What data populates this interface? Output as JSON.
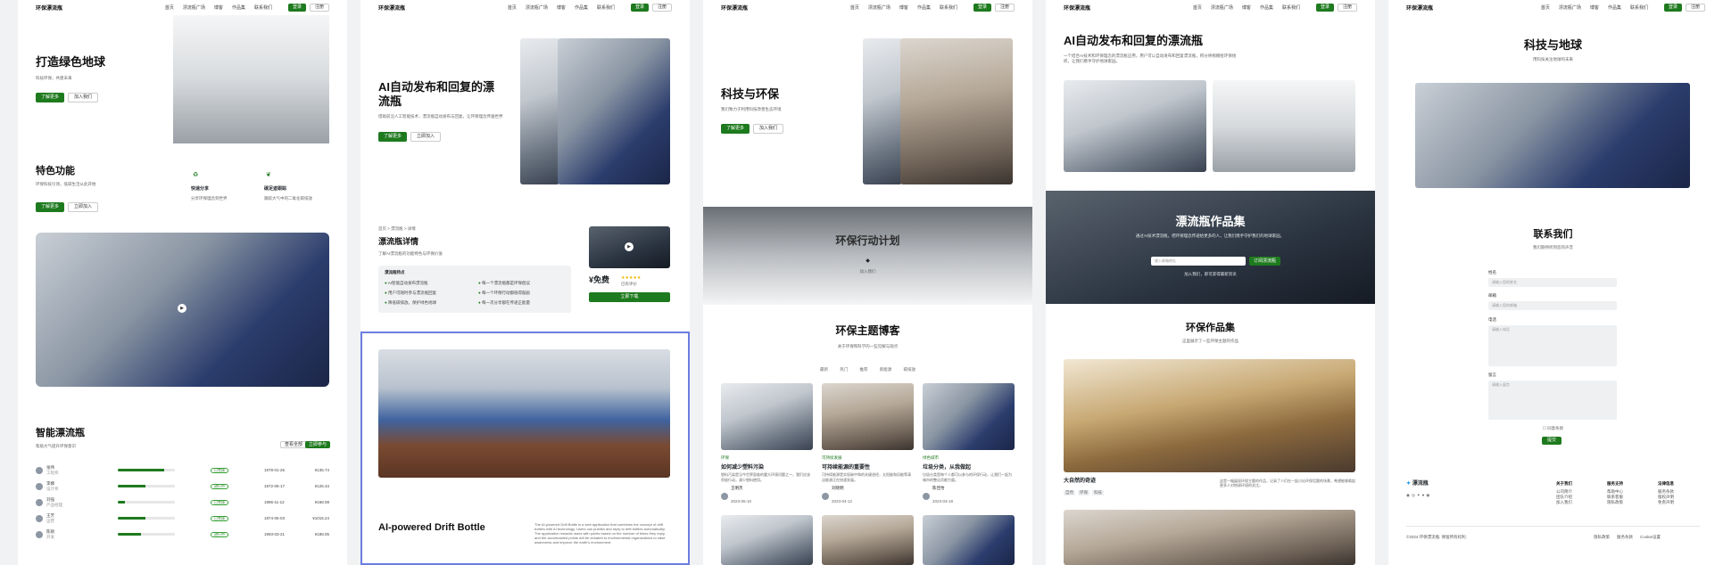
{
  "brand": "环保漂流瓶",
  "nav_links": [
    "首页",
    "漂流瓶广场",
    "博客",
    "作品集",
    "联系我们"
  ],
  "nav_btn_primary": "登录",
  "nav_btn_secondary": "注册",
  "p1": {
    "hero_title": "打造绿色地球",
    "hero_sub": "科技环保，共建未来",
    "btn_primary": "了解更多",
    "btn_secondary": "加入我们",
    "features_title": "特色功能",
    "features_sub": "环保科技引领，低碳生活从此开始",
    "features_btn_primary": "了解更多",
    "features_btn_secondary": "立即加入",
    "feature1_title": "快速分享",
    "feature1_desc": "分享环保理念到世界",
    "feature2_title": "碳足迹跟踪",
    "feature2_desc": "跟踪大气中的二氧化碳排放",
    "table_title": "智能漂流瓶",
    "table_sub": "帮助大气提升环保意识",
    "table_btn_secondary": "查看全部",
    "table_btn_primary": "立即参与",
    "rows": [
      {
        "name": "张伟",
        "role": "工程师",
        "progress": 0.82,
        "status": "已完成",
        "date": "1978-01-26",
        "value": "¥135.74"
      },
      {
        "name": "李娜",
        "role": "设计师",
        "progress": 0.48,
        "status": "进行中",
        "date": "1972-05-17",
        "value": "¥126.34"
      },
      {
        "name": "刘强",
        "role": "产品经理",
        "progress": 0.12,
        "status": "已完成",
        "date": "1996-11-12",
        "value": "¥168.08"
      },
      {
        "name": "王芳",
        "role": "运营",
        "progress": 0.48,
        "status": "已完成",
        "date": "1974-05-03",
        "value": "¥1015.24"
      },
      {
        "name": "陈刚",
        "role": "开发",
        "progress": 0.4,
        "status": "进行中",
        "date": "1993-03-21",
        "value": "¥188.05"
      }
    ]
  },
  "p2": {
    "hero_title": "AI自动发布和回复的漂流瓶",
    "hero_sub": "借助前沿人工智能技术，漂流瓶自动发布与回复，让环保理念传遍世界",
    "btn_primary": "了解更多",
    "btn_secondary": "立即加入",
    "breadcrumb": [
      "首页",
      "漂流瓶",
      "详情"
    ],
    "detail_title": "漂流瓶详情",
    "detail_sub": "了解AI漂流瓶的功能特色与环保价值",
    "features_box_title": "漂流瓶特点",
    "features": [
      "AI智能自动发布漂流瓶",
      "每一个漂流瓶都是环保倡议",
      "用户可随时参与漂流瓶回复",
      "每一个环保行动都值得鼓励",
      "降低碳排放，保护绿色地球",
      "每一次分享都在传递正能量"
    ],
    "price": "¥免费",
    "rating_label": "已有评价",
    "buy_btn": "立即下载",
    "product_title": "AI-powered Drift Bottle",
    "product_desc": "The AI-powered Drift Bottle is a web application that combines the concept of drift bottles with AI technology. Users can publish and reply to drift bottles automatically. The application rewards users with points based on the number of times they reply, and the accumulated points will be donated to environmental organizations to raise awareness and improve the earth's environment."
  },
  "p3": {
    "hero_title": "科技与环保",
    "hero_sub": "我们致力于利用科技改善生态环境",
    "btn_primary": "了解更多",
    "btn_secondary": "加入我们",
    "banner_title": "环保行动计划",
    "banner_sub": "加入我们",
    "blog_title": "环保主题博客",
    "blog_sub": "关于环保和科学的一些见解与观点",
    "tabs": [
      "最新",
      "热门",
      "推荐",
      "新能源",
      "碳排放"
    ],
    "posts": [
      {
        "tag": "环保",
        "title": "如何减少塑料污染",
        "excerpt": "塑料污染是当今世界面临的重大环境问题之一，我们应该积极行动，减少塑料使用。",
        "author": "王明杰",
        "date": "2023-05-10"
      },
      {
        "tag": "可持续发展",
        "title": "可持续能源的重要性",
        "excerpt": "可持续能源是实现碳中和的关键途径，太阳能和风能等清洁能源正在快速发展。",
        "author": "刘晓明",
        "date": "2023-04-12"
      },
      {
        "tag": "绿色城市",
        "title": "垃圾分类，从我做起",
        "excerpt": "垃圾分类是每个人都可以参与的环保行动，让我们一起为城市的整洁贡献力量。",
        "author": "陈佳怡",
        "date": "2023-03-18"
      }
    ]
  },
  "p4": {
    "hero_title": "AI自动发布和回复的漂流瓶",
    "hero_sub": "一个结合AI技术和环保理念的漂流瓶应用，用户可以自动发布和回复漂流瓶，积分将捐赠给环保组织，让我们携手守护地球家园。",
    "gallery_banner_title": "漂流瓶作品集",
    "gallery_banner_sub": "通过AI技术漂流瓶，把环保理念传递给更多的人，让我们携手守护我们的地球家园。",
    "email_placeholder": "输入邮箱地址",
    "subscribe_btn": "订阅漂流瓶",
    "banner_note": "加入我们，即可获得最新资讯",
    "gallery_title": "环保作品集",
    "gallery_sub": "这里展示了一些环保主题的作品",
    "work_title": "大自然的奇迹",
    "work_desc": "这是一幅展现环保主题的作品，记录了人们在一起讨论环保话题的场景，希望能够唤起更多人对地球环境的关注。",
    "work_tags": [
      "自然",
      "环保",
      "科技"
    ]
  },
  "p5": {
    "hero_title": "科技与地球",
    "hero_sub": "用科技关注地球的未来",
    "contact_title": "联系我们",
    "contact_sub": "我们期待听到您的声音",
    "fields": [
      {
        "label": "姓名",
        "placeholder": "请输入您的姓名"
      },
      {
        "label": "邮箱",
        "placeholder": "请输入您的邮箱"
      },
      {
        "label": "电话",
        "placeholder": "请输入电话"
      },
      {
        "label": "留言",
        "placeholder": "请输入留言"
      }
    ],
    "agree_label": "同意条款",
    "submit_btn": "提交",
    "footer_brand": "漂流瓶",
    "footer_cols": [
      {
        "title": "关于我们",
        "items": [
          "公司简介",
          "团队介绍",
          "加入我们"
        ]
      },
      {
        "title": "服务支持",
        "items": [
          "帮助中心",
          "联系客服",
          "隐私政策"
        ]
      },
      {
        "title": "法律信息",
        "items": [
          "服务条款",
          "版权声明",
          "免责声明"
        ]
      }
    ],
    "copyright": "©2024 环保漂流瓶. 保留所有权利.",
    "footer_links": [
      "隐私政策",
      "服务条款",
      "Cookie设置"
    ]
  }
}
